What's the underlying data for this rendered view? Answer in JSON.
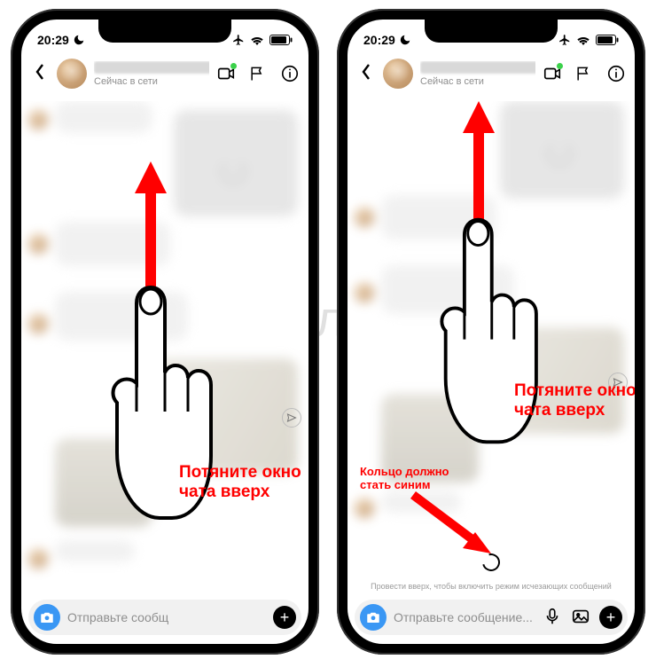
{
  "watermark": "Яблык",
  "statusbar": {
    "time": "20:29"
  },
  "header": {
    "status": "Сейчас в сети"
  },
  "composer": {
    "placeholder_short": "Отправьте сообщ",
    "placeholder_long": "Отправьте сообщение..."
  },
  "annotations": {
    "pull_up": "Потяните окно\nчата вверх",
    "ring_blue": "Кольцо должно\nстать синим",
    "hint": "Провести вверх, чтобы включить режим исчезающих сообщений"
  }
}
